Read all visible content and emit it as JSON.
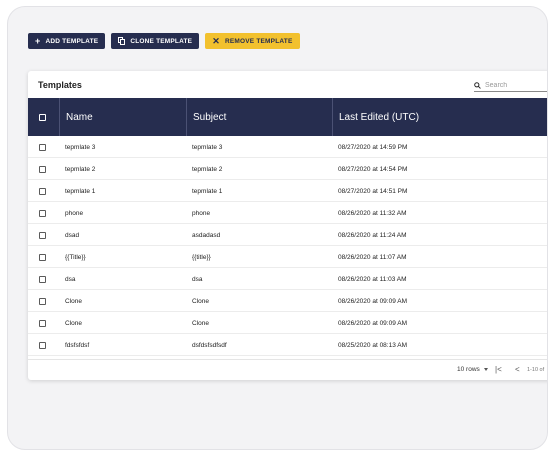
{
  "toolbar": {
    "add_label": "ADD TEMPLATE",
    "clone_label": "CLONE TEMPLATE",
    "remove_label": "REMOVE TEMPLATE"
  },
  "card": {
    "title": "Templates",
    "search_placeholder": "Search"
  },
  "table": {
    "columns": [
      "Name",
      "Subject",
      "Last Edited (UTC)"
    ],
    "rows": [
      {
        "name": "tepmlate 3",
        "subject": "tepmlate 3",
        "edited": "08/27/2020 at 14:59 PM"
      },
      {
        "name": "tepmlate 2",
        "subject": "tepmlate 2",
        "edited": "08/27/2020 at 14:54 PM"
      },
      {
        "name": "tepmlate 1",
        "subject": "tepmlate 1",
        "edited": "08/27/2020 at 14:51 PM"
      },
      {
        "name": "phone",
        "subject": "phone",
        "edited": "08/26/2020 at 11:32 AM"
      },
      {
        "name": "dsad",
        "subject": "asdadasd",
        "edited": "08/26/2020 at 11:24 AM"
      },
      {
        "name": "{{Title}}",
        "subject": "{{title}}",
        "edited": "08/26/2020 at 11:07 AM"
      },
      {
        "name": "dsa",
        "subject": "dsa",
        "edited": "08/26/2020 at 11:03 AM"
      },
      {
        "name": "Clone",
        "subject": "Clone",
        "edited": "08/26/2020 at 09:09 AM"
      },
      {
        "name": "Clone",
        "subject": "Clone",
        "edited": "08/26/2020 at 09:09 AM"
      },
      {
        "name": "fdsfsfdsf",
        "subject": "dsfdsfsdfsdf",
        "edited": "08/25/2020 at 08:13 AM"
      }
    ]
  },
  "footer": {
    "rows_label": "10 rows",
    "range_label": "1-10 of",
    "first_page_icon": "|<",
    "prev_page_icon": "<"
  }
}
